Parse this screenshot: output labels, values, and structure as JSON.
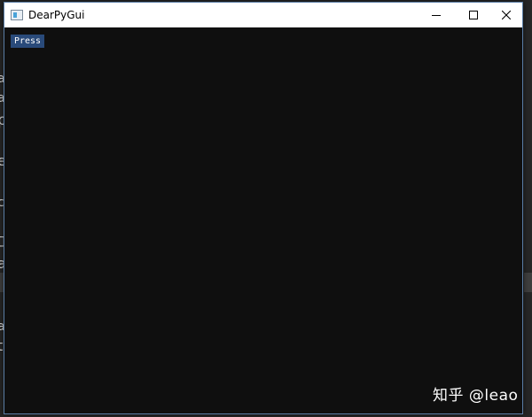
{
  "window": {
    "title": "DearPyGui",
    "icons": {
      "app": "app-window-icon",
      "minimize": "minimize-icon",
      "maximize": "maximize-icon",
      "close": "close-icon"
    }
  },
  "client": {
    "press_button_label": "Press"
  },
  "watermark": {
    "text": "知乎 @leao"
  },
  "background": {
    "fragments": [
      "a",
      "a",
      "p",
      "e",
      "c",
      "工",
      "a",
      "a",
      "t"
    ]
  },
  "colors": {
    "client_bg": "#0f0f0f",
    "button_bg": "#294a7a",
    "titlebar_bg": "#ffffff",
    "window_border": "#5b7ea6"
  }
}
